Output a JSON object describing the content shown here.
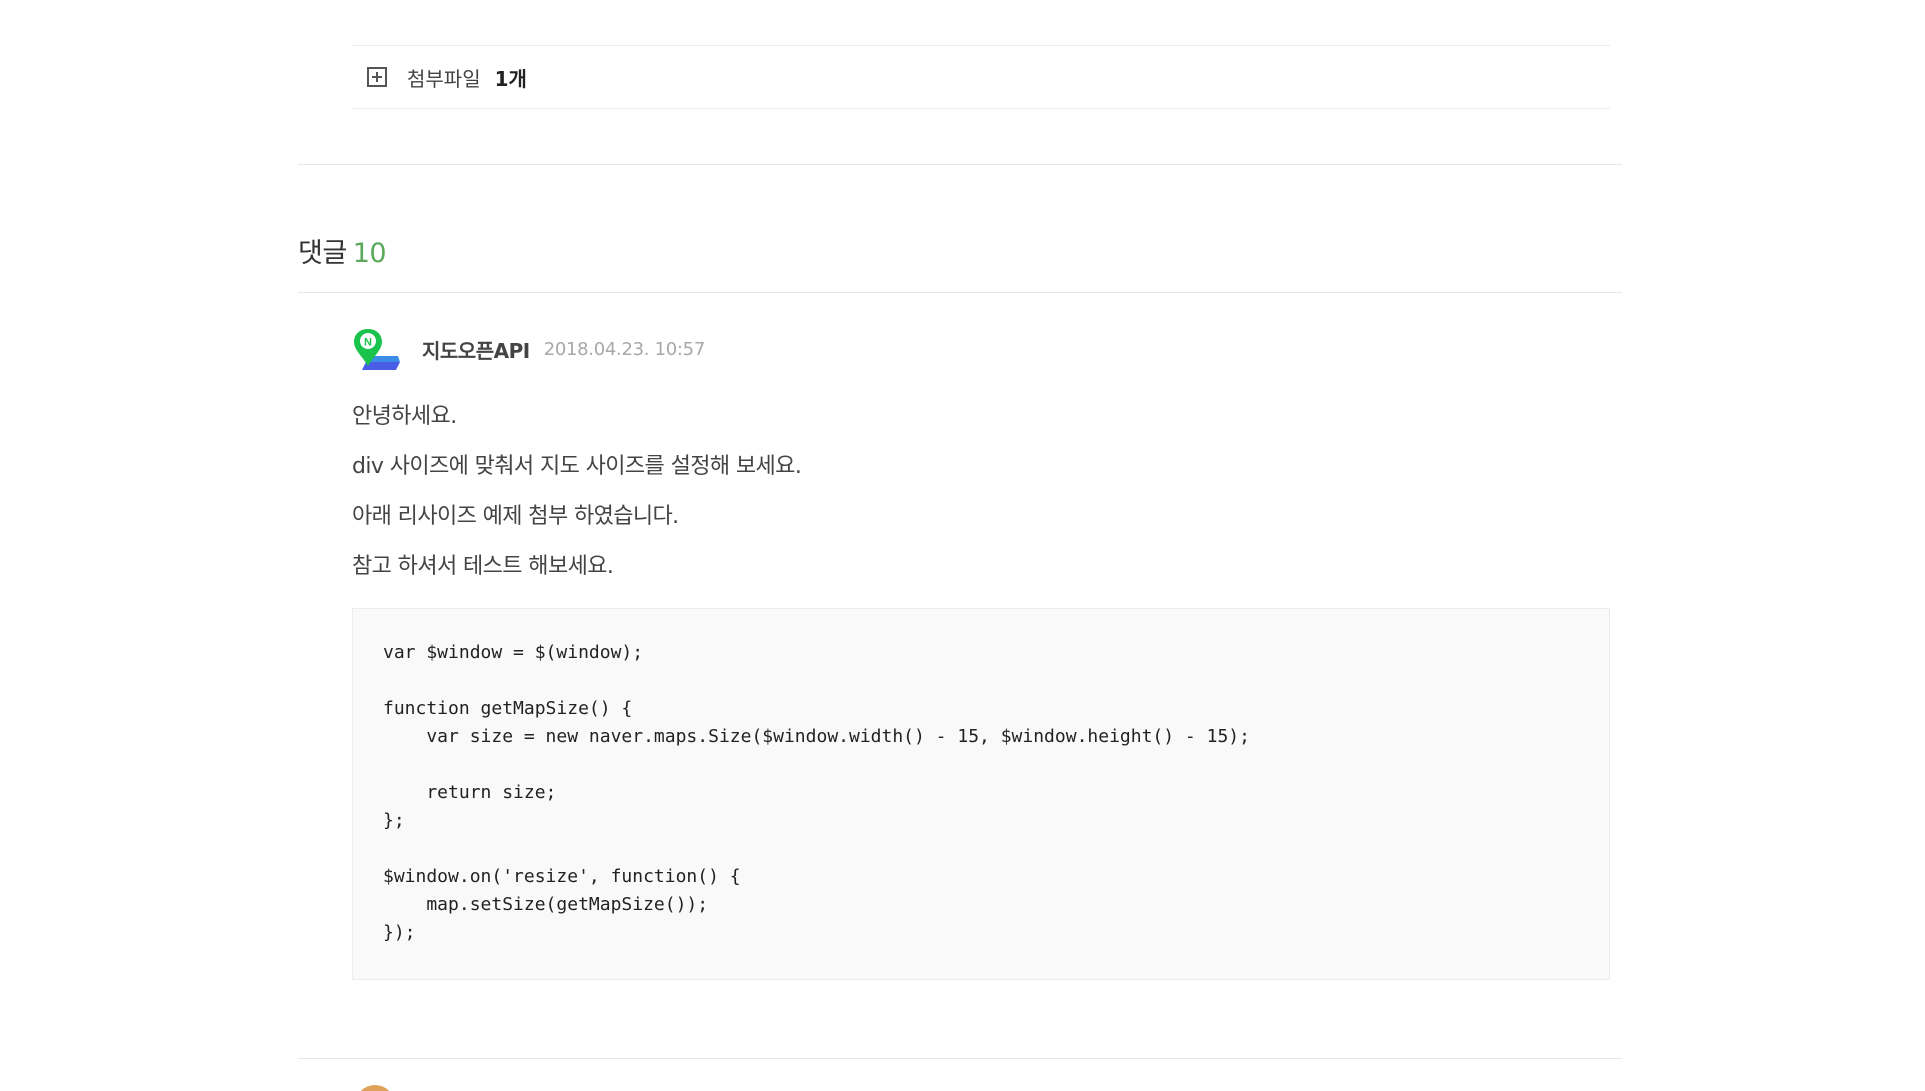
{
  "attachments": {
    "label": "첨부파일",
    "count": "1개"
  },
  "comments_header": {
    "title": "댓글",
    "count": "10"
  },
  "comment": {
    "author": "지도오픈API",
    "date": "2018.04.23. 10:57",
    "lines": [
      "안녕하세요.",
      "div 사이즈에 맞춰서 지도 사이즈를 설정해 보세요.",
      "아래 리사이즈 예제 첨부 하였습니다.",
      "참고 하셔서 테스트 해보세요."
    ],
    "code": "var $window = $(window);\n\nfunction getMapSize() {\n    var size = new naver.maps.Size($window.width() - 15, $window.height() - 15);\n\n    return size;\n};\n\n$window.on('resize', function() {\n    map.setSize(getMapSize());\n});"
  },
  "colors": {
    "accent_green": "#5ca95d",
    "divider": "#e6e6e6",
    "code_bg": "#f9f9f9"
  },
  "icons": {
    "attach_toggle": "plus-square-icon",
    "avatar": "naver-map-logo-icon"
  }
}
